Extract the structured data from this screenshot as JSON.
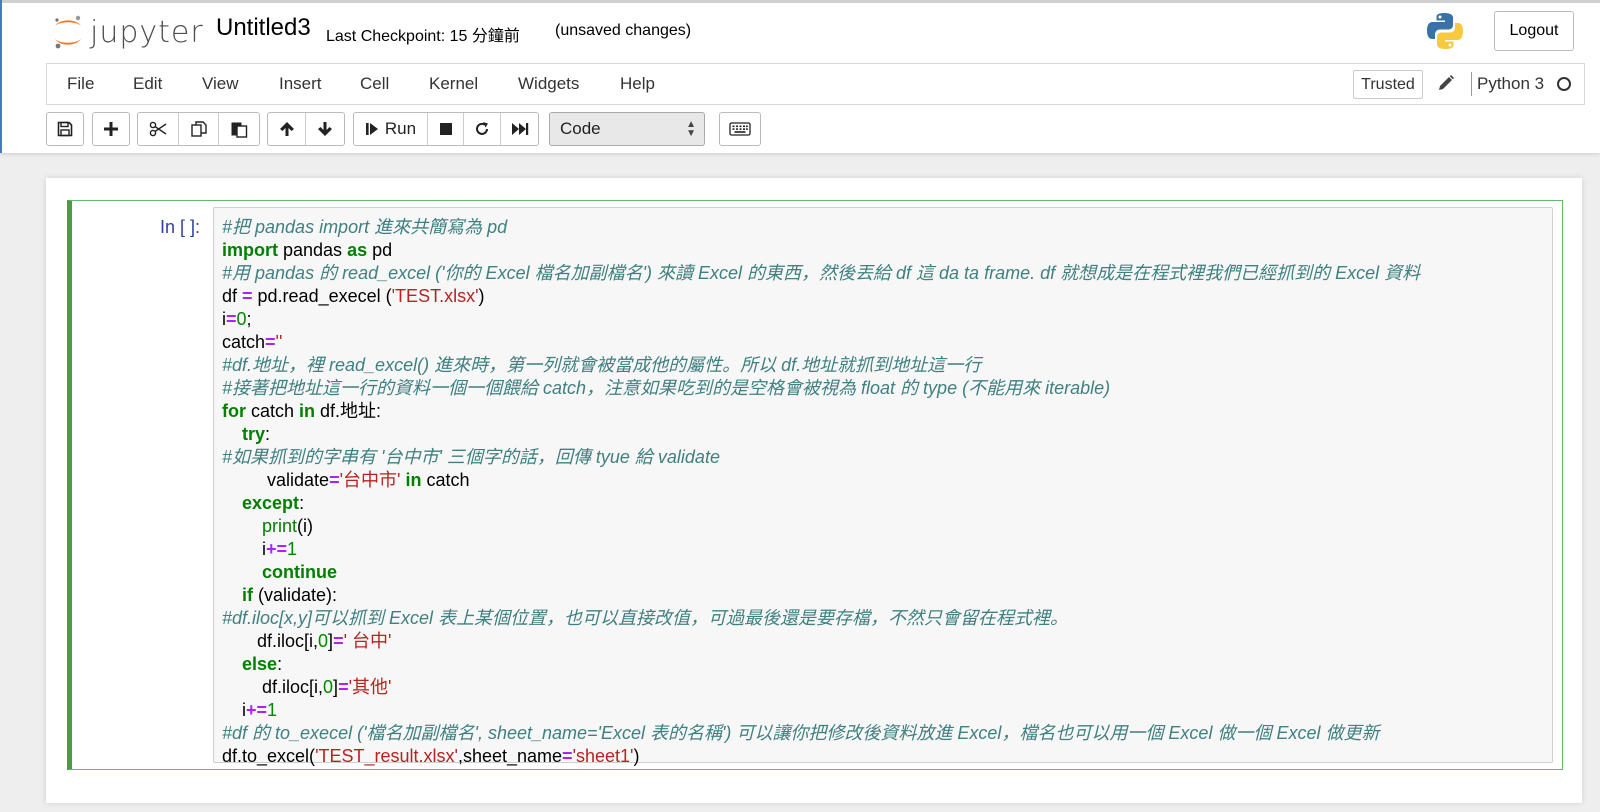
{
  "header": {
    "logo_text": "jupyter",
    "notebook_name": "Untitled3",
    "checkpoint": "Last Checkpoint: 15 分鐘前",
    "save_status": "(unsaved changes)",
    "logout_label": "Logout"
  },
  "menubar": {
    "items": [
      "File",
      "Edit",
      "View",
      "Insert",
      "Cell",
      "Kernel",
      "Widgets",
      "Help"
    ],
    "trusted_label": "Trusted",
    "kernel_name": "Python 3"
  },
  "toolbar": {
    "run_label": "Run",
    "cell_type": "Code",
    "icons": [
      "save-icon",
      "add-icon",
      "cut-icon",
      "copy-icon",
      "paste-icon",
      "move-up-icon",
      "move-down-icon",
      "run-icon",
      "stop-icon",
      "restart-icon",
      "fast-forward-icon",
      "keyboard-icon"
    ]
  },
  "cell": {
    "prompt": "In [ ]:",
    "code": {
      "l1": "#把 pandas import 進來共簡寫為 pd",
      "l2": [
        "import",
        " pandas ",
        "as",
        " pd"
      ],
      "l3": "#用 pandas 的 read_excel ('你的 Excel 檔名加副檔名') 來讀 Excel 的東西，然後丟給 df 這 da ta frame. df 就想成是在程式裡我們已經抓到的 Excel 資料",
      "l4": [
        "df ",
        "=",
        " pd.read_execel (",
        "'TEST.xlsx'",
        ")"
      ],
      "l5": [
        "i",
        "=",
        "0",
        ";"
      ],
      "l6": [
        "catch",
        "=",
        "''"
      ],
      "l7": "#df.地址，裡 read_excel() 進來時，第一列就會被當成他的屬性。所以 df.地址就抓到地址這一行",
      "l8": "#接著把地址這一行的資料一個一個餵給 catch，注意如果吃到的是空格會被視為 float 的 type (不能用來 iterable)",
      "l9": [
        "for",
        " catch ",
        "in",
        " df.地址:"
      ],
      "l10": [
        "    ",
        "try",
        ":"
      ],
      "l11": "#如果抓到的字串有 '台中市' 三個字的話，回傳 tyue 給 validate",
      "l12": [
        "         validate",
        "=",
        "'台中市'",
        " ",
        "in",
        " catch"
      ],
      "l13": [
        "    ",
        "except",
        ":"
      ],
      "l14": [
        "        ",
        "print",
        "(i)"
      ],
      "l15": [
        "        i",
        "+=",
        "1"
      ],
      "l16": [
        "        ",
        "continue"
      ],
      "l17": [
        "    ",
        "if",
        " (validate):"
      ],
      "l18": "#df.iloc[x,y]可以抓到 Excel 表上某個位置，也可以直接改值，可過最後還是要存檔，不然只會留在程式裡。",
      "l19": [
        "       df.iloc[i,",
        "0",
        "]",
        "=",
        "' 台中'"
      ],
      "l20": [
        "    ",
        "else",
        ":"
      ],
      "l21": [
        "        df.iloc[i,",
        "0",
        "]",
        "=",
        "'其他'"
      ],
      "l22": [
        "    i",
        "+=",
        "1"
      ],
      "l23": "#df 的 to_execel ('檔名加副檔名', sheet_name='Excel 表的名稱') 可以讓你把修改後資料放進 Excel，檔名也可以用一個 Excel 做一個 Excel 做更新",
      "l24": [
        "df.to_excel(",
        "'TEST_result.xlsx'",
        ",sheet_name",
        "=",
        "'sheet1'",
        ")"
      ]
    }
  },
  "colors": {
    "comment": "#408080",
    "keyword": "#008000",
    "operator": "#aa22ff",
    "string": "#ba2121",
    "cell_border": "#43a047",
    "prompt": "#303f9f"
  }
}
